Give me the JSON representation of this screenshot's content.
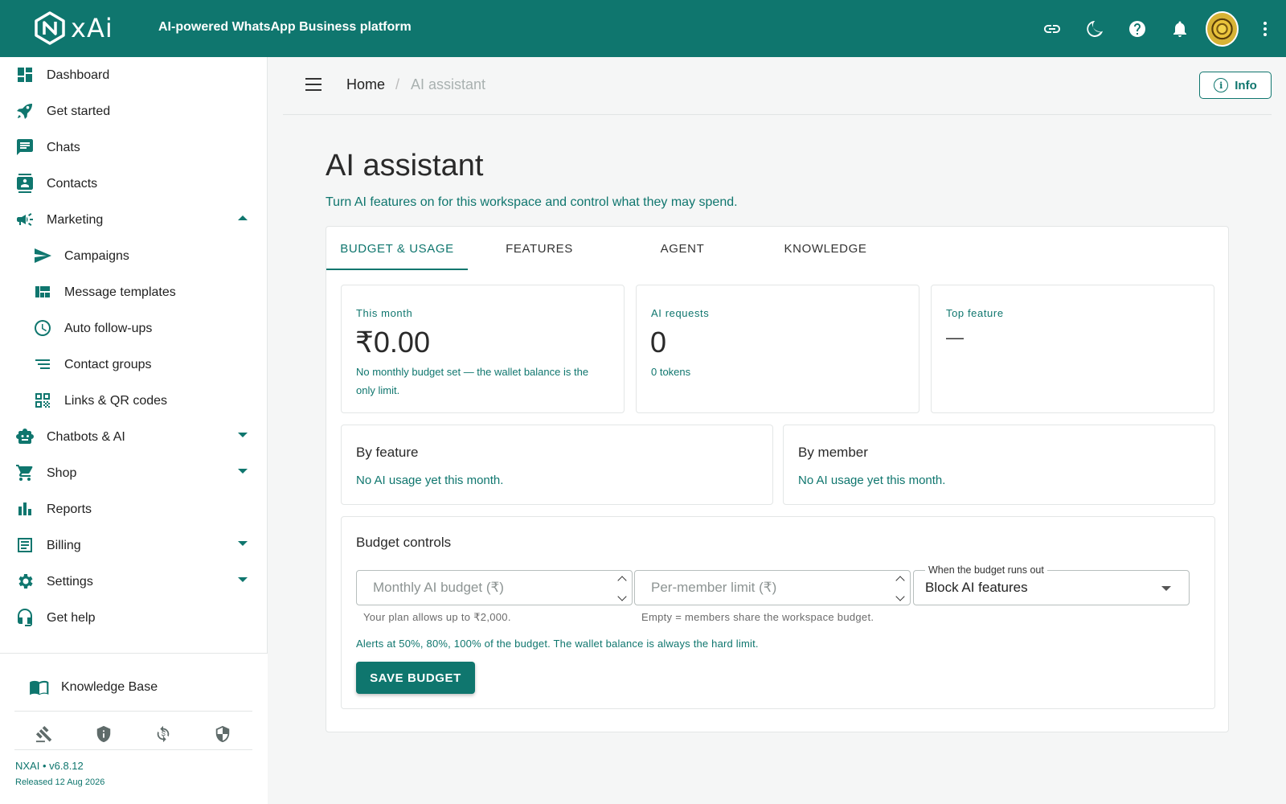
{
  "header": {
    "logo_text": "xAi",
    "tagline": "AI-powered WhatsApp Business platform",
    "icons": [
      "link-icon",
      "moon-icon",
      "help-icon",
      "bell-icon",
      "avatar",
      "more-vert-icon"
    ]
  },
  "sidebar": {
    "items": [
      {
        "label": "Dashboard",
        "icon": "dashboard-icon"
      },
      {
        "label": "Get started",
        "icon": "rocket-icon"
      },
      {
        "label": "Chats",
        "icon": "chat-icon"
      },
      {
        "label": "Contacts",
        "icon": "contacts-icon"
      },
      {
        "label": "Marketing",
        "icon": "megaphone-icon",
        "expanded": true
      },
      {
        "label": "Campaigns",
        "icon": "send-icon"
      },
      {
        "label": "Message templates",
        "icon": "template-icon"
      },
      {
        "label": "Auto follow-ups",
        "icon": "clock-icon"
      },
      {
        "label": "Contact groups",
        "icon": "list-icon"
      },
      {
        "label": "Links & QR codes",
        "icon": "qr-icon"
      },
      {
        "label": "Chatbots & AI",
        "icon": "robot-icon"
      },
      {
        "label": "Shop",
        "icon": "cart-icon"
      },
      {
        "label": "Reports",
        "icon": "bar-chart-icon"
      },
      {
        "label": "Billing",
        "icon": "receipt-icon"
      },
      {
        "label": "Settings",
        "icon": "gear-icon"
      },
      {
        "label": "Get help",
        "icon": "headset-icon"
      }
    ],
    "knowledge_base": "Knowledge Base",
    "version": "NXAI • v6.8.12",
    "released": "Released 12 Aug 2026"
  },
  "breadcrumb": {
    "home": "Home",
    "separator": "/",
    "current": "AI assistant",
    "info_label": "Info"
  },
  "page": {
    "title": "AI assistant",
    "subtitle": "Turn AI features on for this workspace and control what they may spend."
  },
  "tabs": [
    {
      "label": "BUDGET & USAGE",
      "active": true
    },
    {
      "label": "FEATURES",
      "active": false
    },
    {
      "label": "AGENT",
      "active": false
    },
    {
      "label": "KNOWLEDGE",
      "active": false
    }
  ],
  "stats": {
    "this_month": {
      "caption": "This month",
      "value": "₹0.00",
      "note": "No monthly budget set — the wallet balance is the only limit."
    },
    "ai_requests": {
      "caption": "AI requests",
      "value": "0",
      "note": "0 tokens"
    },
    "top_feature": {
      "caption": "Top feature",
      "value": "—"
    }
  },
  "by_feature": {
    "title": "By feature",
    "empty": "No AI usage yet this month."
  },
  "by_member": {
    "title": "By member",
    "empty": "No AI usage yet this month."
  },
  "budget_controls": {
    "title": "Budget controls",
    "monthly_placeholder": "Monthly AI budget (₹)",
    "monthly_helper": "Your plan allows up to ₹2,000.",
    "member_placeholder": "Per-member limit (₹)",
    "member_helper": "Empty = members share the workspace budget.",
    "runout_label": "When the budget runs out",
    "runout_value": "Block AI features",
    "alerts": "Alerts at 50%, 80%, 100% of the budget. The wallet balance is always the hard limit.",
    "save_label": "SAVE BUDGET"
  },
  "colors": {
    "brand": "#0f766e"
  }
}
